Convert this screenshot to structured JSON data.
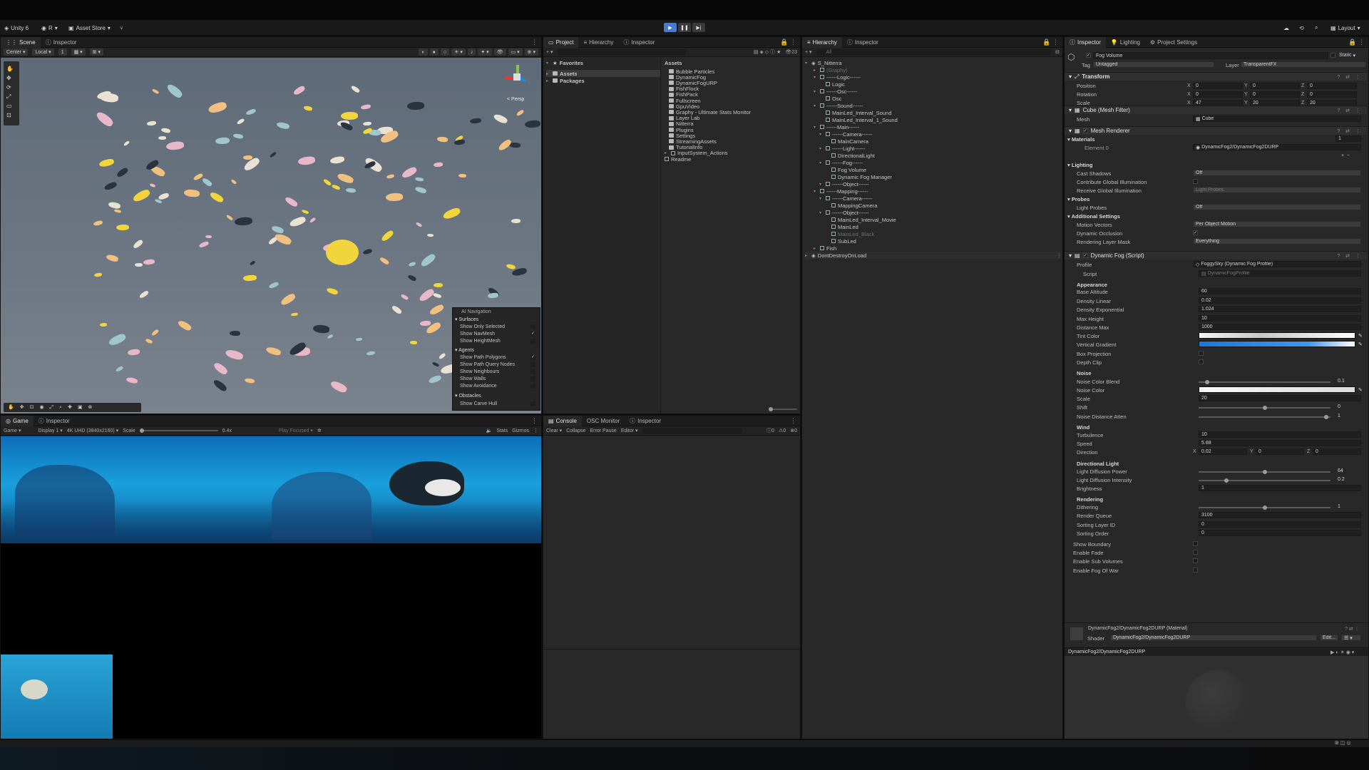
{
  "toolbar": {
    "app": "Unity 6",
    "account": "R",
    "asset_store": "Asset Store",
    "layout": "Layout"
  },
  "scene": {
    "tabs": [
      "Scene",
      "Inspector"
    ],
    "pivot": "Center",
    "space": "Local",
    "grid_count": "1",
    "persp": "< Persp",
    "nav_menu": {
      "title": "AI Navigation",
      "surfaces": "Surfaces",
      "surfaces_items": [
        {
          "label": "Show Only Selected",
          "checked": false
        },
        {
          "label": "Show NavMesh",
          "checked": true
        },
        {
          "label": "Show HeightMesh",
          "checked": false
        }
      ],
      "agents": "Agents",
      "agents_items": [
        {
          "label": "Show Path Polygons",
          "checked": true
        },
        {
          "label": "Show Path Query Nodes",
          "checked": false
        },
        {
          "label": "Show Neighbours",
          "checked": false
        },
        {
          "label": "Show Walls",
          "checked": false
        },
        {
          "label": "Show Avoidance",
          "checked": false
        }
      ],
      "obstacles": "Obstacles",
      "obstacles_items": [
        {
          "label": "Show Carve Hull",
          "checked": false
        }
      ]
    }
  },
  "game": {
    "tabs": [
      "Game",
      "Inspector"
    ],
    "mode": "Game",
    "display": "Display 1",
    "resolution": "4K UHD (3840x2160)",
    "scale_label": "Scale",
    "scale_value": "0.4x",
    "play_focused": "Play Focused",
    "stats": "Stats",
    "gizmos": "Gizmos"
  },
  "project": {
    "tabs": [
      "Project",
      "Hierarchy",
      "Inspector"
    ],
    "count": "23",
    "favorites": "Favorites",
    "roots": [
      "Assets",
      "Packages"
    ],
    "assets_header": "Assets",
    "items": [
      "Bubble Particles",
      "DynamicFog",
      "DynamicFogURP",
      "FishFlock",
      "FishPack",
      "Fullscreen",
      "GpuVideo",
      "Graphy - Ultimate Stats Monitor",
      "Layer Lab",
      "Nitterra",
      "Plugins",
      "Settings",
      "StreamingAssets",
      "TutorialInfo",
      "InputSystem_Actions",
      "Readme"
    ]
  },
  "console": {
    "tabs": [
      "Console",
      "OSC Monitor",
      "Inspector"
    ],
    "clear": "Clear",
    "collapse": "Collapse",
    "error_pause": "Error Pause",
    "editor": "Editor",
    "counts": [
      "0",
      "0",
      "0"
    ]
  },
  "hierarchy": {
    "tabs": [
      "Hierarchy",
      "Inspector"
    ],
    "search_placeholder": "All",
    "scene": "S_Nitterra",
    "rows": [
      {
        "label": "(Graphy)",
        "depth": 1,
        "dim": true
      },
      {
        "label": "------Logic------",
        "depth": 1
      },
      {
        "label": "Logic",
        "depth": 2
      },
      {
        "label": "------Osc------",
        "depth": 1
      },
      {
        "label": "Osc",
        "depth": 2
      },
      {
        "label": "------Sound------",
        "depth": 1
      },
      {
        "label": "MainLed_Interval_Sound",
        "depth": 2
      },
      {
        "label": "MainLed_Interval_1_Sound",
        "depth": 2
      },
      {
        "label": "------Main------",
        "depth": 1
      },
      {
        "label": "------Camera------",
        "depth": 2
      },
      {
        "label": "MainCamera",
        "depth": 3
      },
      {
        "label": "------Light------",
        "depth": 2
      },
      {
        "label": "DirectionalLight",
        "depth": 3
      },
      {
        "label": "------Fog------",
        "depth": 2
      },
      {
        "label": "Fog Volume",
        "depth": 3
      },
      {
        "label": "Dynamic Fog Manager",
        "depth": 3
      },
      {
        "label": "------Object------",
        "depth": 2
      },
      {
        "label": "------Mapping------",
        "depth": 1
      },
      {
        "label": "------Camera------",
        "depth": 2
      },
      {
        "label": "MappingCamera",
        "depth": 3
      },
      {
        "label": "------Object------",
        "depth": 2
      },
      {
        "label": "MainLed_Interval_Movie",
        "depth": 3
      },
      {
        "label": "MainLed",
        "depth": 3
      },
      {
        "label": "MainLed_Black",
        "depth": 3,
        "dim": true
      },
      {
        "label": "SubLed",
        "depth": 3
      },
      {
        "label": "Fish",
        "depth": 1
      }
    ],
    "dontdestroy": "DontDestroyOnLoad"
  },
  "inspector": {
    "tabs": [
      "Inspector",
      "Lighting",
      "Project Settings"
    ],
    "object_name": "Fog Volume",
    "static": "Static",
    "tag_label": "Tag",
    "tag": "Untagged",
    "layer_label": "Layer",
    "layer": "TransparentFX",
    "transform": {
      "title": "Transform",
      "position": {
        "label": "Position",
        "x": "0",
        "y": "0",
        "z": "0"
      },
      "rotation": {
        "label": "Rotation",
        "x": "0",
        "y": "0",
        "z": "0"
      },
      "scale": {
        "label": "Scale",
        "x": "47",
        "y": "20",
        "z": "20"
      }
    },
    "mesh_filter": {
      "title": "Cube (Mesh Filter)",
      "mesh_label": "Mesh",
      "mesh": "Cube"
    },
    "mesh_renderer": {
      "title": "Mesh Renderer",
      "materials": "Materials",
      "materials_count": "1",
      "element0_label": "Element 0",
      "element0": "DynamicFog2/DynamicFog2DURP",
      "lighting": "Lighting",
      "cast_shadows_label": "Cast Shadows",
      "cast_shadows": "Off",
      "contribute_gi": "Contribute Global Illumination",
      "receive_gi_label": "Receive Global Illumination",
      "receive_gi": "Light Probes",
      "probes": "Probes",
      "light_probes_label": "Light Probes",
      "light_probes": "Off",
      "additional": "Additional Settings",
      "motion_vectors_label": "Motion Vectors",
      "motion_vectors": "Per Object Motion",
      "dynamic_occlusion": "Dynamic Occlusion",
      "rendering_layer_label": "Rendering Layer Mask",
      "rendering_layer": "Everything"
    },
    "dynamic_fog": {
      "title": "Dynamic Fog (Script)",
      "profile_label": "Profile",
      "profile": "FoggySky (Dynamic Fog Profile)",
      "script_label": "Script",
      "script": "DynamicFogProfile",
      "appearance": "Appearance",
      "base_altitude_label": "Base Altitude",
      "base_altitude": "60",
      "density_linear_label": "Density Linear",
      "density_linear": "0.02",
      "density_exp_label": "Density Exponential",
      "density_exp": "1.024",
      "max_height_label": "Max Height",
      "max_height": "10",
      "distance_max_label": "Distance Max",
      "distance_max": "1000",
      "tint_label": "Tint Color",
      "vgrad_label": "Vertical Gradient",
      "box_proj_label": "Box Projection",
      "depth_clip_label": "Depth Clip",
      "noise": "Noise",
      "noise_blend_label": "Noise Color Blend",
      "noise_blend": "0.1",
      "noise_color_label": "Noise Color",
      "scale_label": "Scale",
      "scale": "20",
      "shift_label": "Shift",
      "shift": "0",
      "noise_atten_label": "Noise Distance Atten",
      "noise_atten": "1",
      "wind": "Wind",
      "turbulence_label": "Turbulence",
      "turbulence": "10",
      "speed_label": "Speed",
      "speed": "5.68",
      "direction_label": "Direction",
      "dir_x": "0.02",
      "dir_y": "0",
      "dir_z": "0",
      "dirlight": "Directional Light",
      "ldp_label": "Light Diffusion Power",
      "ldp": "64",
      "ldi_label": "Light Diffusion Intensity",
      "ldi": "0.2",
      "brightness_label": "Brightness",
      "brightness": "1",
      "rendering": "Rendering",
      "dithering_label": "Dithering",
      "dithering": "1",
      "render_queue_label": "Render Queue",
      "render_queue": "3100",
      "sorting_layer_label": "Sorting Layer ID",
      "sorting_layer": "0",
      "sorting_order_label": "Sorting Order",
      "sorting_order": "0",
      "show_boundary": "Show Boundary",
      "enable_fade": "Enable Fade",
      "enable_sub": "Enable Sub Volumes",
      "enable_fow": "Enable Fog Of War"
    },
    "material": {
      "title": "DynamicFog2/DynamicFog2DURP (Material)",
      "shader_label": "Shader",
      "shader": "DynamicFog2/DynamicFog2DURP",
      "edit": "Edit..."
    },
    "preview_title": "DynamicFog2/DynamicFog2DURP"
  },
  "colors": {
    "accent": "#4a7ac8",
    "panel": "#282828",
    "fog_top": "#1a78d8"
  }
}
